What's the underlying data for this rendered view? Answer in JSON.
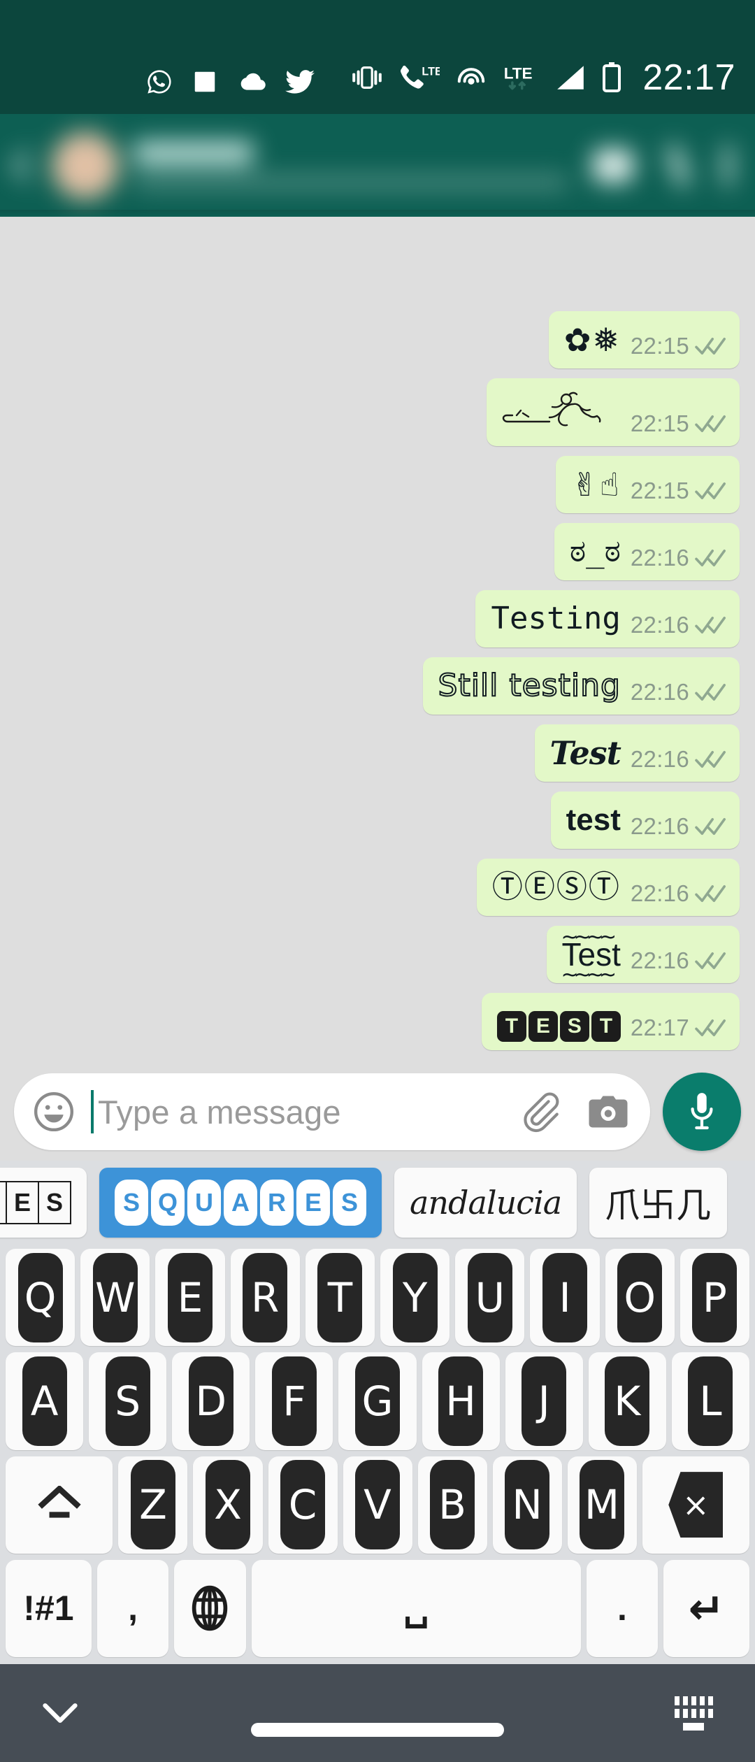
{
  "status_bar": {
    "time": "22:17",
    "left_icons": [
      "whatsapp-icon",
      "gallery-icon",
      "cloud-icon",
      "twitter-icon"
    ],
    "right_icons": [
      "vibrate-icon",
      "lte-call-icon",
      "hotspot-icon",
      "lte-data-icon",
      "signal-icon",
      "battery-icon"
    ],
    "lte_label": "LTE",
    "bg_color": "#0c463d"
  },
  "app_bar": {
    "blurred": "true",
    "back_label": "back-arrow",
    "contact_name": "",
    "contact_status": "",
    "actions": [
      "video-call",
      "voice-call",
      "overflow-menu"
    ],
    "bg_color": "#0d5f53"
  },
  "chat": {
    "bg_color": "#dedede",
    "bubble_color": "#e3f8c8",
    "timestamp_color": "#8a9a8c",
    "tick_color": "#8fa890",
    "messages": [
      {
        "text": "✿❅",
        "style": "fv-emoji",
        "time": "22:15",
        "status": "read"
      },
      {
        "text": "Ὣ6‍♂️",
        "style": "fv-stick",
        "time": "22:15",
        "status": "read"
      },
      {
        "text": "✌☝",
        "style": "fv-emoji",
        "time": "22:15",
        "status": "read"
      },
      {
        "text": "ಠ_ಠ",
        "style": "fv-mono",
        "time": "22:16",
        "status": "read"
      },
      {
        "text": "Testing",
        "style": "fv-mono",
        "time": "22:16",
        "status": "read"
      },
      {
        "text": "Still testing",
        "style": "fv-outline",
        "time": "22:16",
        "status": "read"
      },
      {
        "text": "Test",
        "style": "fv-script",
        "time": "22:16",
        "status": "read"
      },
      {
        "text": "test",
        "style": "fv-sans",
        "time": "22:16",
        "status": "read"
      },
      {
        "text": "ⓉⒺⓈⓉ",
        "style": "fv-circled",
        "time": "22:16",
        "status": "read"
      },
      {
        "text": "Test",
        "style": "fv-squig",
        "time": "22:16",
        "status": "read"
      },
      {
        "text": "TEST",
        "style": "fv-negsq",
        "time": "22:17",
        "status": "read"
      }
    ]
  },
  "composer": {
    "placeholder": "Type a message",
    "value": "",
    "emoji_icon": "smiley-icon",
    "attach_icon": "paperclip-icon",
    "camera_icon": "camera-icon",
    "mic_icon": "microphone-icon",
    "mic_bg": "#0a7d6c"
  },
  "suggestions": {
    "selected_index": 1,
    "selected_color": "#3d93d8",
    "items": [
      {
        "label": "RES",
        "render": "boxed",
        "selected": false
      },
      {
        "label": "SQUARES",
        "render": "roundwhite",
        "selected": true
      },
      {
        "label": "andalucia",
        "render": "cursive",
        "selected": false
      },
      {
        "label": "爪卐几",
        "render": "cjk",
        "selected": false
      }
    ]
  },
  "keyboard": {
    "rows": [
      {
        "keys": [
          {
            "label": "Q",
            "type": "letter"
          },
          {
            "label": "W",
            "type": "letter"
          },
          {
            "label": "E",
            "type": "letter"
          },
          {
            "label": "R",
            "type": "letter"
          },
          {
            "label": "T",
            "type": "letter"
          },
          {
            "label": "Y",
            "type": "letter"
          },
          {
            "label": "U",
            "type": "letter"
          },
          {
            "label": "I",
            "type": "letter"
          },
          {
            "label": "O",
            "type": "letter"
          },
          {
            "label": "P",
            "type": "letter"
          }
        ]
      },
      {
        "keys": [
          {
            "label": "A",
            "type": "letter"
          },
          {
            "label": "S",
            "type": "letter"
          },
          {
            "label": "D",
            "type": "letter"
          },
          {
            "label": "F",
            "type": "letter"
          },
          {
            "label": "G",
            "type": "letter"
          },
          {
            "label": "H",
            "type": "letter"
          },
          {
            "label": "J",
            "type": "letter"
          },
          {
            "label": "K",
            "type": "letter"
          },
          {
            "label": "L",
            "type": "letter"
          }
        ]
      },
      {
        "keys": [
          {
            "label": "shift",
            "type": "shift"
          },
          {
            "label": "Z",
            "type": "letter"
          },
          {
            "label": "X",
            "type": "letter"
          },
          {
            "label": "C",
            "type": "letter"
          },
          {
            "label": "V",
            "type": "letter"
          },
          {
            "label": "B",
            "type": "letter"
          },
          {
            "label": "N",
            "type": "letter"
          },
          {
            "label": "M",
            "type": "letter"
          },
          {
            "label": "backspace",
            "type": "backspace",
            "glyph": "×"
          }
        ]
      },
      {
        "keys": [
          {
            "label": "!#1",
            "type": "symbols"
          },
          {
            "label": ",",
            "type": "punct"
          },
          {
            "label": "globe",
            "type": "language",
            "glyph": "⊕"
          },
          {
            "label": "space",
            "type": "space",
            "glyph": "␣"
          },
          {
            "label": ".",
            "type": "punct"
          },
          {
            "label": "enter",
            "type": "enter",
            "glyph": "↵"
          }
        ]
      }
    ],
    "key_bg": "#fafafa",
    "keycap_bg": "#262626",
    "keyboard_bg": "#dcdee1"
  },
  "nav_bar": {
    "bg_color": "#464d55",
    "hide_keyboard_icon": "chevron-down-icon",
    "home_pill": "gesture-home-pill",
    "switch_keyboard_icon": "keyboard-switch-icon"
  }
}
